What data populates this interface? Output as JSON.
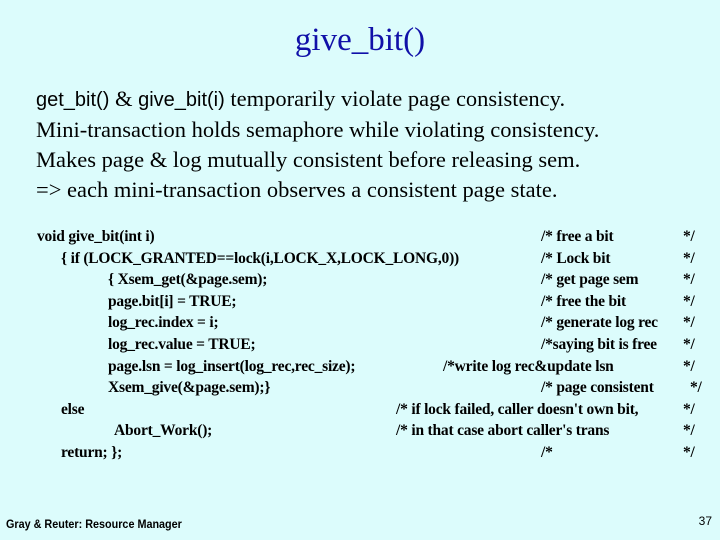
{
  "slide": {
    "title": "give_bit()",
    "bullets": {
      "line1_a": "get_bit() ",
      "line1_b": "& ",
      "line1_c": " give_bit(i)",
      "line1_d": " temporarily violate page consistency.",
      "line2": "Mini-transaction holds semaphore while violating consistency.",
      "line3": "Makes page & log mutually consistent before releasing sem.",
      "line4": "=> each mini-transaction observes a consistent page state."
    },
    "code": [
      {
        "pre": "void  ",
        "fn": "give_bit",
        "post": "(int i)",
        "comment": "/* free a bit",
        "end": "*/"
      },
      {
        "code": "{ if (LOCK_GRANTED==lock(i,LOCK_X,LOCK_LONG,0))",
        "comment": "/* Lock  bit",
        "end": "*/"
      },
      {
        "code": "{ Xsem_get(&page.sem);",
        "comment": "/* get  page sem",
        "end": "*/"
      },
      {
        "code": "page.bit[i] = TRUE;",
        "comment": "/* free the bit",
        "end": "*/"
      },
      {
        "code": "log_rec.index = i;",
        "comment": "/* generate log rec",
        "end": "*/"
      },
      {
        "code": "log_rec.value = TRUE;",
        "comment": "/*saying bit is free",
        "end": "*/"
      },
      {
        "code": "page.lsn = log_insert(log_rec,rec_size);",
        "comment": "/*write log rec&update lsn",
        "end": "*/"
      },
      {
        "code": "Xsem_give(&page.sem);}",
        "comment": "/* page consistent",
        "end": "*/"
      },
      {
        "code": "else",
        "comment": "/* if lock failed, caller doesn't own bit,",
        "end": "*/"
      },
      {
        "code": "Abort_Work();",
        "comment": "/*   in that case abort caller's trans",
        "end": "*/"
      },
      {
        "code": "return; };",
        "comment": "/*",
        "end": "*/"
      }
    ],
    "footer": "Gray & Reuter: Resource Manager",
    "page_number": "37"
  }
}
